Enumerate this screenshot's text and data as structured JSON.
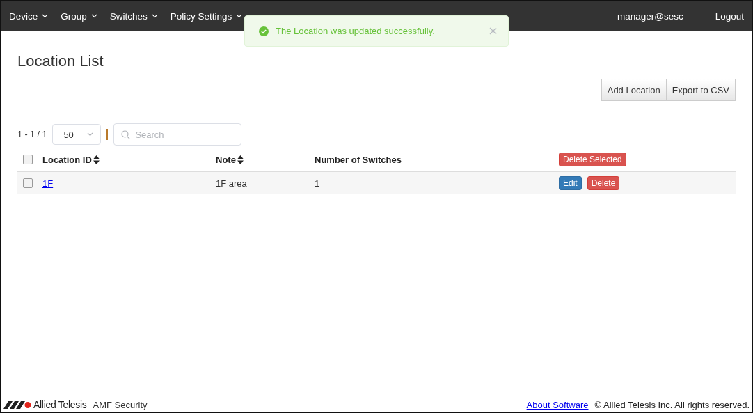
{
  "nav": {
    "items": [
      {
        "label": "Device"
      },
      {
        "label": "Group"
      },
      {
        "label": "Switches"
      },
      {
        "label": "Policy Settings"
      }
    ],
    "user": "manager@sesc",
    "logout": "Logout"
  },
  "toast": {
    "message": "The Location was updated successfully."
  },
  "page": {
    "title": "Location List",
    "actions": [
      "Add Location",
      "Export to CSV"
    ]
  },
  "toolbar": {
    "range": "1 - 1 / 1",
    "page_size": "50",
    "search": {
      "placeholder": "Search"
    }
  },
  "table": {
    "columns": [
      {
        "label": "Location ID",
        "sortable": true
      },
      {
        "label": "Note",
        "sortable": true
      },
      {
        "label": "Number of Switches",
        "sortable": false
      }
    ],
    "bulk_action": "Delete Selected",
    "header_checked": false,
    "rows": [
      {
        "checked": false,
        "id": "1F",
        "note": "1F area",
        "switches": "1",
        "actions": [
          "Edit",
          "Delete"
        ]
      }
    ]
  },
  "footer": {
    "brand": "Allied Telesis",
    "product": "AMF Security",
    "link": "About Software",
    "copyright": "© Allied Telesis Inc. All rights reserved."
  }
}
